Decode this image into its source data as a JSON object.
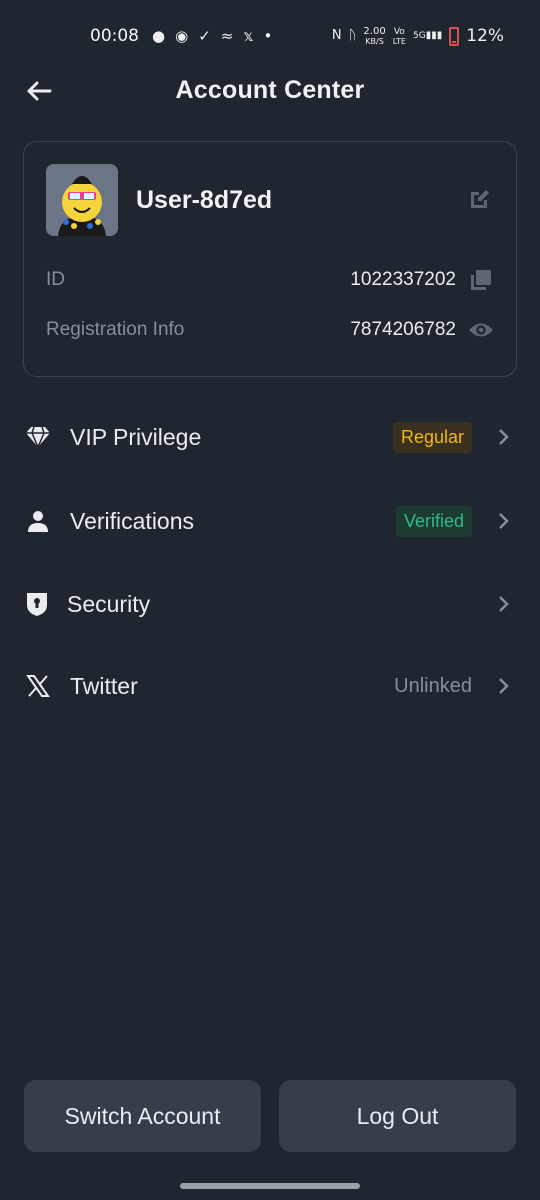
{
  "status_bar": {
    "time": "00:08",
    "net_speed": "2.00",
    "net_unit": "KB/S",
    "volte_top": "Vo",
    "volte_bottom": "LTE",
    "signal": "5G",
    "battery": "12%"
  },
  "header": {
    "title": "Account Center"
  },
  "profile": {
    "username": "User-8d7ed",
    "id_label": "ID",
    "id_value": "1022337202",
    "reg_label": "Registration Info",
    "reg_value": "7874206782"
  },
  "menu": [
    {
      "label": "VIP Privilege",
      "icon": "diamond-icon",
      "badge": "Regular",
      "badge_color": "#f0b90b"
    },
    {
      "label": "Verifications",
      "icon": "person-icon",
      "badge": "Verified",
      "badge_color": "#2ebd85"
    },
    {
      "label": "Security",
      "icon": "shield-icon"
    },
    {
      "label": "Twitter",
      "icon": "x-logo-icon",
      "status": "Unlinked"
    }
  ],
  "actions": {
    "switch_account": "Switch Account",
    "log_out": "Log Out"
  },
  "colors": {
    "background": "#1f2630",
    "accent_yellow": "#f0b90b",
    "accent_green": "#2ebd85",
    "muted_text": "#848e9c",
    "button_bg": "#363e4b"
  }
}
